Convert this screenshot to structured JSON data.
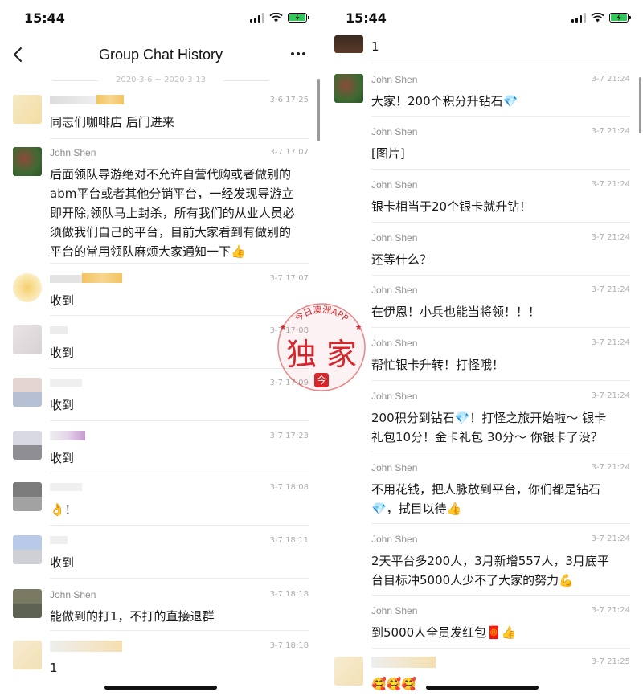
{
  "screens": [
    {
      "status_time": "15:44",
      "title": "Group Chat History",
      "date_range": "2020-3-6 ~ 2020-3-13",
      "messages": [
        {
          "sender": "",
          "time": "3-6 17:25",
          "lines": [
            "同志们咖啡店 后门进来"
          ]
        },
        {
          "sender": "John Shen",
          "time": "3-7 17:07",
          "lines": [
            "后面领队导游绝对不允许自营代购或者做别的",
            "abm平台或者其他分销平台，一经发现导游立",
            "即开除,领队马上封杀，所有我们的从业人员必",
            "须做我们自己的平台，目前大家看到有做别的",
            "平台的常用领队麻烦大家通知一下👍"
          ]
        },
        {
          "sender": "",
          "time": "3-7 17:07",
          "lines": [
            "收到"
          ]
        },
        {
          "sender": "",
          "time": "3-7 17:08",
          "lines": [
            "收到"
          ]
        },
        {
          "sender": "",
          "time": "3-7 17:09",
          "lines": [
            "收到"
          ]
        },
        {
          "sender": "",
          "time": "3-7 17:23",
          "lines": [
            "收到"
          ]
        },
        {
          "sender": "",
          "time": "3-7 18:08",
          "lines": [
            "👌！"
          ]
        },
        {
          "sender": "",
          "time": "3-7 18:11",
          "lines": [
            "收到"
          ]
        },
        {
          "sender": "John Shen",
          "time": "3-7 18:18",
          "lines": [
            "能做到的打1，不打的直接退群"
          ]
        },
        {
          "sender": "",
          "time": "3-7 18:18",
          "lines": [
            "1"
          ]
        }
      ]
    },
    {
      "status_time": "15:44",
      "messages": [
        {
          "sender": "",
          "time": "",
          "lines": [
            "1"
          ]
        },
        {
          "sender": "John Shen",
          "time": "3-7 21:24",
          "lines": [
            "大家！200个积分升钻石💎"
          ]
        },
        {
          "sender": "John Shen",
          "time": "3-7 21:24",
          "lines": [
            "[图片]"
          ]
        },
        {
          "sender": "John Shen",
          "time": "3-7 21:24",
          "lines": [
            "银卡相当于20个银卡就升钻！"
          ]
        },
        {
          "sender": "John Shen",
          "time": "3-7 21:24",
          "lines": [
            "还等什么？"
          ]
        },
        {
          "sender": "John Shen",
          "time": "3-7 21:24",
          "lines": [
            "在伊恩！小兵也能当将领！！！"
          ]
        },
        {
          "sender": "John Shen",
          "time": "3-7 21:24",
          "lines": [
            "帮忙银卡升转！打怪哦！"
          ]
        },
        {
          "sender": "John Shen",
          "time": "3-7 21:24",
          "lines": [
            "200积分到钻石💎！打怪之旅开始啦～ 银卡",
            "礼包10分！金卡礼包 30分～ 你银卡了没？"
          ]
        },
        {
          "sender": "John Shen",
          "time": "3-7 21:24",
          "lines": [
            "不用花钱，把人脉放到平台，你们都是钻石",
            "💎，拭目以待👍"
          ]
        },
        {
          "sender": "John Shen",
          "time": "3-7 21:24",
          "lines": [
            "2天平台多200人，3月新增557人，3月底平",
            "台目标冲5000人少不了大家的努力💪"
          ]
        },
        {
          "sender": "John Shen",
          "time": "3-7 21:24",
          "lines": [
            "到5000人全员发红包🧧👍"
          ]
        },
        {
          "sender": "",
          "time": "3-7 21:25",
          "lines": [
            "🥰🥰🥰"
          ]
        }
      ]
    }
  ],
  "watermark": {
    "arc_text": "今日澳洲APP",
    "big_text": "独 家",
    "badge": "今"
  },
  "colors": {
    "accent_red": "#d7262b",
    "battery_green": "#34c759"
  },
  "icons": [
    "back-arrow-icon",
    "more-icon",
    "signal-icon",
    "wifi-icon",
    "battery-icon"
  ]
}
